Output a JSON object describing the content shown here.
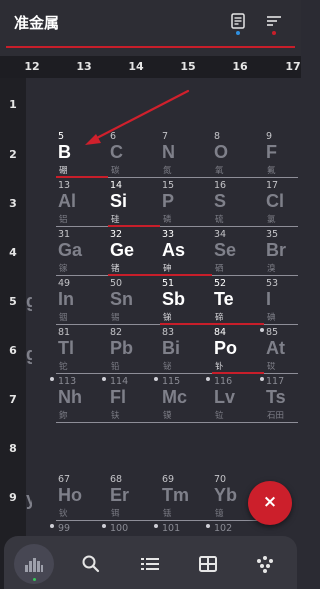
{
  "header": {
    "title": "准金属"
  },
  "columns": [
    "12",
    "13",
    "14",
    "15",
    "16",
    "17"
  ],
  "rows": [
    "1",
    "2",
    "3",
    "4",
    "5",
    "6",
    "7",
    "8",
    "9"
  ],
  "elements": {
    "b": {
      "num": "5",
      "sym": "B",
      "cn": "硼"
    },
    "c": {
      "num": "6",
      "sym": "C",
      "cn": "碳"
    },
    "n": {
      "num": "7",
      "sym": "N",
      "cn": "氮"
    },
    "o": {
      "num": "8",
      "sym": "O",
      "cn": "氧"
    },
    "f": {
      "num": "9",
      "sym": "F",
      "cn": "氟"
    },
    "al": {
      "num": "13",
      "sym": "Al",
      "cn": "铝"
    },
    "si": {
      "num": "14",
      "sym": "Si",
      "cn": "硅"
    },
    "p": {
      "num": "15",
      "sym": "P",
      "cn": "磷"
    },
    "s": {
      "num": "16",
      "sym": "S",
      "cn": "硫"
    },
    "cl": {
      "num": "17",
      "sym": "Cl",
      "cn": "氯"
    },
    "ga": {
      "num": "31",
      "sym": "Ga",
      "cn": "镓"
    },
    "ge": {
      "num": "32",
      "sym": "Ge",
      "cn": "锗"
    },
    "as": {
      "num": "33",
      "sym": "As",
      "cn": "砷"
    },
    "se": {
      "num": "34",
      "sym": "Se",
      "cn": "硒"
    },
    "br": {
      "num": "35",
      "sym": "Br",
      "cn": "溴"
    },
    "in": {
      "num": "49",
      "sym": "In",
      "cn": "铟"
    },
    "sn": {
      "num": "50",
      "sym": "Sn",
      "cn": "锡"
    },
    "sb": {
      "num": "51",
      "sym": "Sb",
      "cn": "锑"
    },
    "te": {
      "num": "52",
      "sym": "Te",
      "cn": "碲"
    },
    "i": {
      "num": "53",
      "sym": "I",
      "cn": "碘"
    },
    "tl": {
      "num": "81",
      "sym": "Tl",
      "cn": "铊"
    },
    "pb": {
      "num": "82",
      "sym": "Pb",
      "cn": "铅"
    },
    "bi": {
      "num": "83",
      "sym": "Bi",
      "cn": "铋"
    },
    "po": {
      "num": "84",
      "sym": "Po",
      "cn": "钋"
    },
    "at": {
      "num": "85",
      "sym": "At",
      "cn": "砹"
    },
    "nh": {
      "num": "113",
      "sym": "Nh",
      "cn": "鉨"
    },
    "fl": {
      "num": "114",
      "sym": "Fl",
      "cn": "𫓧"
    },
    "mc": {
      "num": "115",
      "sym": "Mc",
      "cn": "镆"
    },
    "lv": {
      "num": "116",
      "sym": "Lv",
      "cn": "𫟷"
    },
    "ts": {
      "num": "117",
      "sym": "Ts",
      "cn": "石田"
    },
    "ho": {
      "num": "67",
      "sym": "Ho",
      "cn": "钬"
    },
    "er": {
      "num": "68",
      "sym": "Er",
      "cn": "铒"
    },
    "tm": {
      "num": "69",
      "sym": "Tm",
      "cn": "铥"
    },
    "yb": {
      "num": "70",
      "sym": "Yb",
      "cn": "镱"
    },
    "r10c2": {
      "num": "99"
    },
    "r10c3": {
      "num": "100"
    },
    "r10c4": {
      "num": "101"
    },
    "r10c5": {
      "num": "102"
    }
  },
  "fab": {
    "label": "×"
  },
  "colors": {
    "accent": "#c81e2a",
    "fab": "#cc1f2b",
    "indicator_blue": "#2f8fe0",
    "indicator_green": "#35c759"
  },
  "icons": [
    "table-view-icon",
    "sort-icon",
    "tile-view-icon",
    "search-icon",
    "list-icon",
    "grid-icon",
    "dots-icon"
  ]
}
